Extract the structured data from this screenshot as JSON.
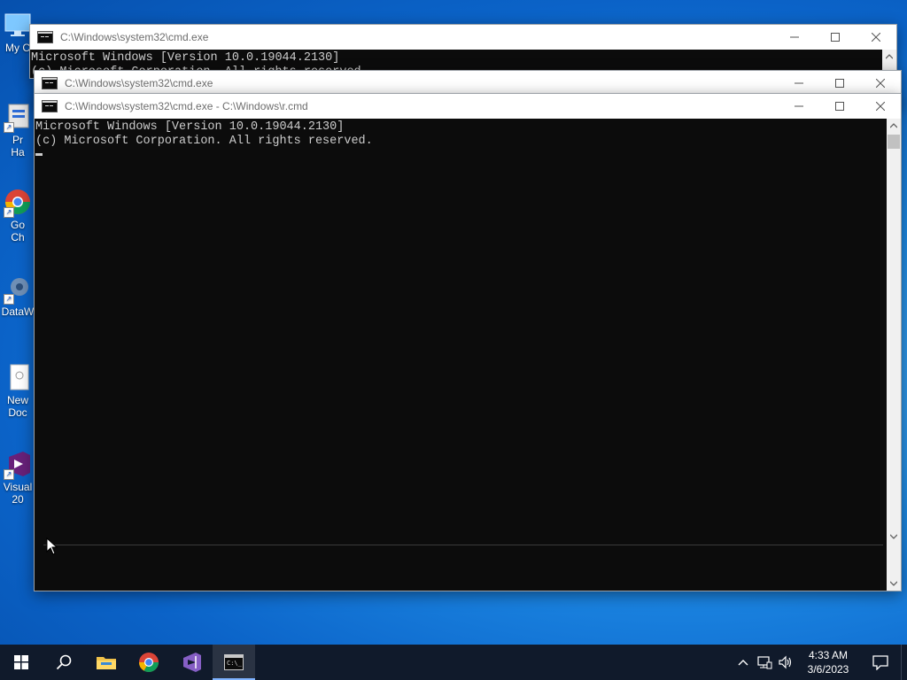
{
  "desktop": {
    "icons": [
      {
        "id": "my-computer",
        "label": "My C",
        "icon": "monitor-icon"
      },
      {
        "id": "process-hacker",
        "label": "Pr\nHa",
        "icon": "process-hacker-icon"
      },
      {
        "id": "google-chrome",
        "label": "Go\nCh",
        "icon": "chrome-icon"
      },
      {
        "id": "datawatch",
        "label": "DataW",
        "icon": "gear-icon"
      },
      {
        "id": "new-document",
        "label": "New\nDoc",
        "icon": "document-icon"
      },
      {
        "id": "visual-studio",
        "label": "Visual\n20",
        "icon": "visual-studio-icon"
      }
    ]
  },
  "windows": [
    {
      "id": "cmd-back",
      "title": "C:\\Windows\\system32\\cmd.exe",
      "lines": [
        "Microsoft Windows [Version 10.0.19044.2130]",
        "(c) Microsoft Corporation. All rights reserved."
      ]
    },
    {
      "id": "cmd-middle",
      "title": "C:\\Windows\\system32\\cmd.exe",
      "lines": []
    },
    {
      "id": "cmd-front",
      "title": "C:\\Windows\\system32\\cmd.exe - C:\\Windows\\r.cmd",
      "lines": [
        "Microsoft Windows [Version 10.0.19044.2130]",
        "(c) Microsoft Corporation. All rights reserved."
      ]
    }
  ],
  "taskbar": {
    "start": "start-icon",
    "search": "search-icon",
    "pinned": [
      {
        "id": "file-explorer",
        "icon": "folder-icon"
      },
      {
        "id": "chrome",
        "icon": "chrome-icon"
      },
      {
        "id": "visual-studio",
        "icon": "visual-studio-icon"
      },
      {
        "id": "command-prompt",
        "icon": "cmd-icon",
        "active": true
      }
    ],
    "tray": [
      "chevron-up-icon",
      "network-icon",
      "volume-icon"
    ],
    "time": "4:33 AM",
    "date": "3/6/2023",
    "notifications": "notification-icon"
  },
  "colors": {
    "console_bg": "#0c0c0c",
    "console_text": "#cccccc",
    "taskbar_bg": "#101a2b",
    "desktop_blue": "#0b63c8"
  }
}
